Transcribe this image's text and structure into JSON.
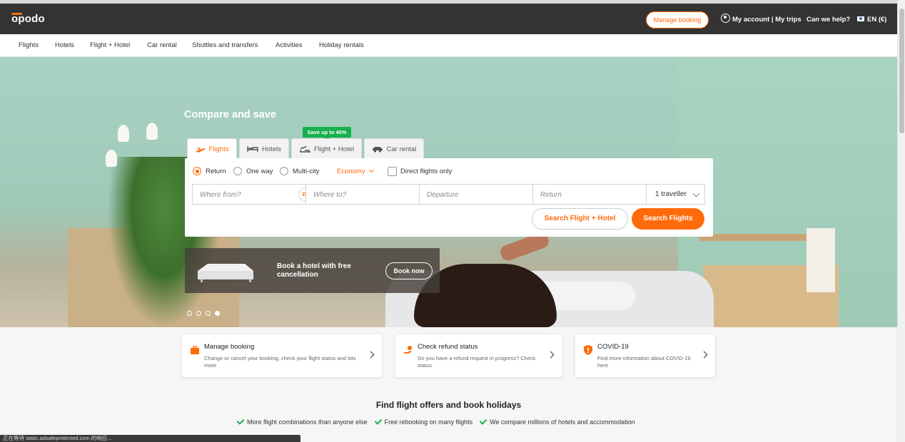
{
  "brand": {
    "logo": "opodo",
    "accent": "#ff6b0a",
    "dark": "#333333",
    "green": "#17b04c"
  },
  "header": {
    "manage_booking": "Manage booking",
    "my_account": "My account | My trips",
    "help": "Can we help?",
    "language": "EN (€)"
  },
  "nav": {
    "items": [
      "Flights",
      "Hotels",
      "Flight + Hotel",
      "Car rental",
      "Shuttles and transfers",
      "Activities",
      "Holiday rentals"
    ]
  },
  "hero": {
    "title": "Compare and save",
    "promo_badge": "Save up to 40%",
    "tabs": [
      "Flights",
      "Hotels",
      "Flight + Hotel",
      "Car rental"
    ],
    "active_tab": "Flights",
    "trip_types": [
      "Return",
      "One way",
      "Multi-city"
    ],
    "selected_trip_type": "Return",
    "cabin_class": "Economy",
    "direct_flights_label": "Direct flights only",
    "direct_flights_checked": false,
    "from_placeholder": "Where from?",
    "to_placeholder": "Where to?",
    "departure_placeholder": "Departure",
    "return_placeholder": "Return",
    "travellers": "1 traveller",
    "search_flight_hotel": "Search Flight + Hotel",
    "search_flights": "Search Flights",
    "hotel_promo_text": "Book a hotel with free cancellation",
    "hotel_promo_button": "Book now",
    "carousel": {
      "slides": 4,
      "active": 4
    }
  },
  "cards": [
    {
      "title": "Manage booking",
      "desc": "Change or cancel your booking, check your flight status and lots more",
      "icon": "briefcase-icon"
    },
    {
      "title": "Check refund status",
      "desc": "Do you have a refund request in progress? Check status",
      "icon": "refund-hand-icon"
    },
    {
      "title": "COVID-19",
      "desc": "Find more information about COVID-19 here",
      "icon": "shield-alert-icon"
    }
  ],
  "offers": {
    "title": "Find flight offers and book holidays",
    "usps": [
      "More flight combinations than anyone else",
      "Free rebooking on many flights",
      "We compare millions of hotels and accommodation"
    ]
  },
  "status_bar": "正在等待 static.adsafeprotected.com 的响应..."
}
